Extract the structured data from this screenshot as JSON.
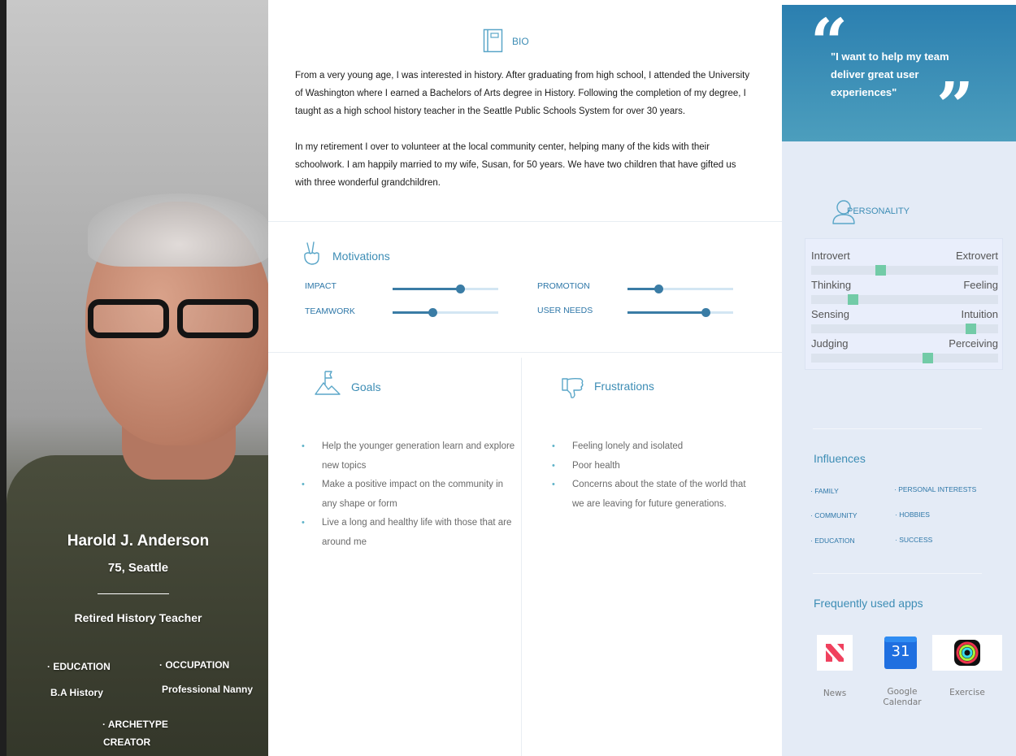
{
  "profile": {
    "name": "Harold J. Anderson",
    "age_location": "75, Seattle",
    "role": "Retired History Teacher",
    "education_label": "· EDUCATION",
    "education_value": "B.A History",
    "occupation_label": "· OCCUPATION",
    "occupation_value": "Professional Nanny",
    "archetype_label": "· ARCHETYPE",
    "archetype_value": "CREATOR"
  },
  "bio": {
    "title": "BIO",
    "paragraphs": [
      "From a very young age, I was interested in history. After graduating from high school, I attended the University of Washington where I earned a Bachelors of Arts degree in History. Following the completion of my degree, I taught as a high school history teacher in the Seattle Public Schools System for over 30 years.",
      "In my retirement I over to volunteer at the local community center, helping many of the kids with their schoolwork. I am happily married to my wife, Susan, for 50 years. We have two  children that have gifted us with three wonderful grandchildren."
    ]
  },
  "motivations": {
    "title": "Motivations",
    "items": [
      {
        "label": "IMPACT",
        "level": 0.64
      },
      {
        "label": "TEAMWORK",
        "level": 0.38
      },
      {
        "label": "PROMOTION",
        "level": 0.29
      },
      {
        "label": "USER NEEDS",
        "level": 0.74
      }
    ]
  },
  "goals": {
    "title": "Goals",
    "items": [
      "Help the younger generation learn and explore new topics",
      "Make a positive impact on the community in any shape or form",
      "Live a long and healthy life with those that are around me"
    ]
  },
  "frustrations": {
    "title": "Frustrations",
    "items": [
      "Feeling lonely and isolated",
      "Poor health",
      "Concerns about the state of the world that we are leaving for future generations."
    ]
  },
  "quote": {
    "text": "\"I want to help my team deliver great user experiences\"",
    "open_mark": "“",
    "close_mark": "”"
  },
  "personality": {
    "title": "PERSONALITY",
    "traits": [
      {
        "left": "Introvert",
        "right": "Extrovert",
        "level": 0.37
      },
      {
        "left": "Thinking",
        "right": "Feeling",
        "level": 0.22
      },
      {
        "left": "Sensing",
        "right": "Intuition",
        "level": 0.85
      },
      {
        "left": "Judging",
        "right": "Perceiving",
        "level": 0.62
      }
    ]
  },
  "influences": {
    "title": "Influences",
    "items": [
      "· FAMILY",
      "· PERSONAL INTERESTS",
      "· COMMUNITY",
      "· HOBBIES",
      "· EDUCATION",
      "· SUCCESS"
    ]
  },
  "apps": {
    "title": "Frequently used apps",
    "items": [
      {
        "name": "News",
        "icon": "news-app-icon"
      },
      {
        "name": "Google\nCalendar",
        "icon": "google-calendar-app-icon",
        "badge": "31"
      },
      {
        "name": "Exercise",
        "icon": "exercise-rings-app-icon"
      }
    ]
  },
  "colors": {
    "accent": "#3d8db5",
    "slider": "#3a7ca5",
    "personality_mark": "#72cba7",
    "right_panel": "#e4ebf6"
  }
}
